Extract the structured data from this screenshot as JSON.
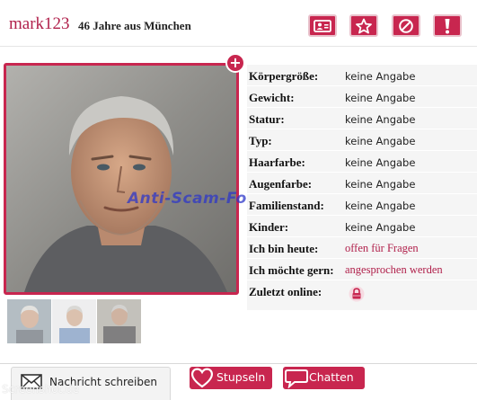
{
  "header": {
    "username": "mark123",
    "age_city": "46 Jahre aus München",
    "actions": [
      {
        "icon": "profile-card-icon"
      },
      {
        "icon": "star-icon"
      },
      {
        "icon": "block-icon"
      },
      {
        "icon": "report-icon"
      }
    ]
  },
  "photo": {
    "add_symbol": "+",
    "watermark": "Anti-Scam-Forum.NL"
  },
  "details": [
    {
      "label": "Körpergröße:",
      "value": "keine Angabe"
    },
    {
      "label": "Gewicht:",
      "value": "keine Angabe"
    },
    {
      "label": "Statur:",
      "value": "keine Angabe"
    },
    {
      "label": "Typ:",
      "value": "keine Angabe"
    },
    {
      "label": "Haarfarbe:",
      "value": "keine Angabe"
    },
    {
      "label": "Augenfarbe:",
      "value": "keine Angabe"
    },
    {
      "label": "Familienstand:",
      "value": "keine Angabe"
    },
    {
      "label": "Kinder:",
      "value": "keine Angabe"
    },
    {
      "label": "Ich bin heute:",
      "value": "offen für Fragen"
    },
    {
      "label": "Ich möchte gern:",
      "value": "angesprochen werden"
    },
    {
      "label": "Zuletzt online:",
      "icon": "lock-icon"
    }
  ],
  "thumbnails": 3,
  "actions": {
    "message_label": "Nachricht schreiben",
    "nudge_label": "Stupseln",
    "chat_label": "Chatten"
  },
  "footer_watermark": "Screenshot.de",
  "colors": {
    "accent": "#c8264f",
    "username": "#b01f4a"
  }
}
